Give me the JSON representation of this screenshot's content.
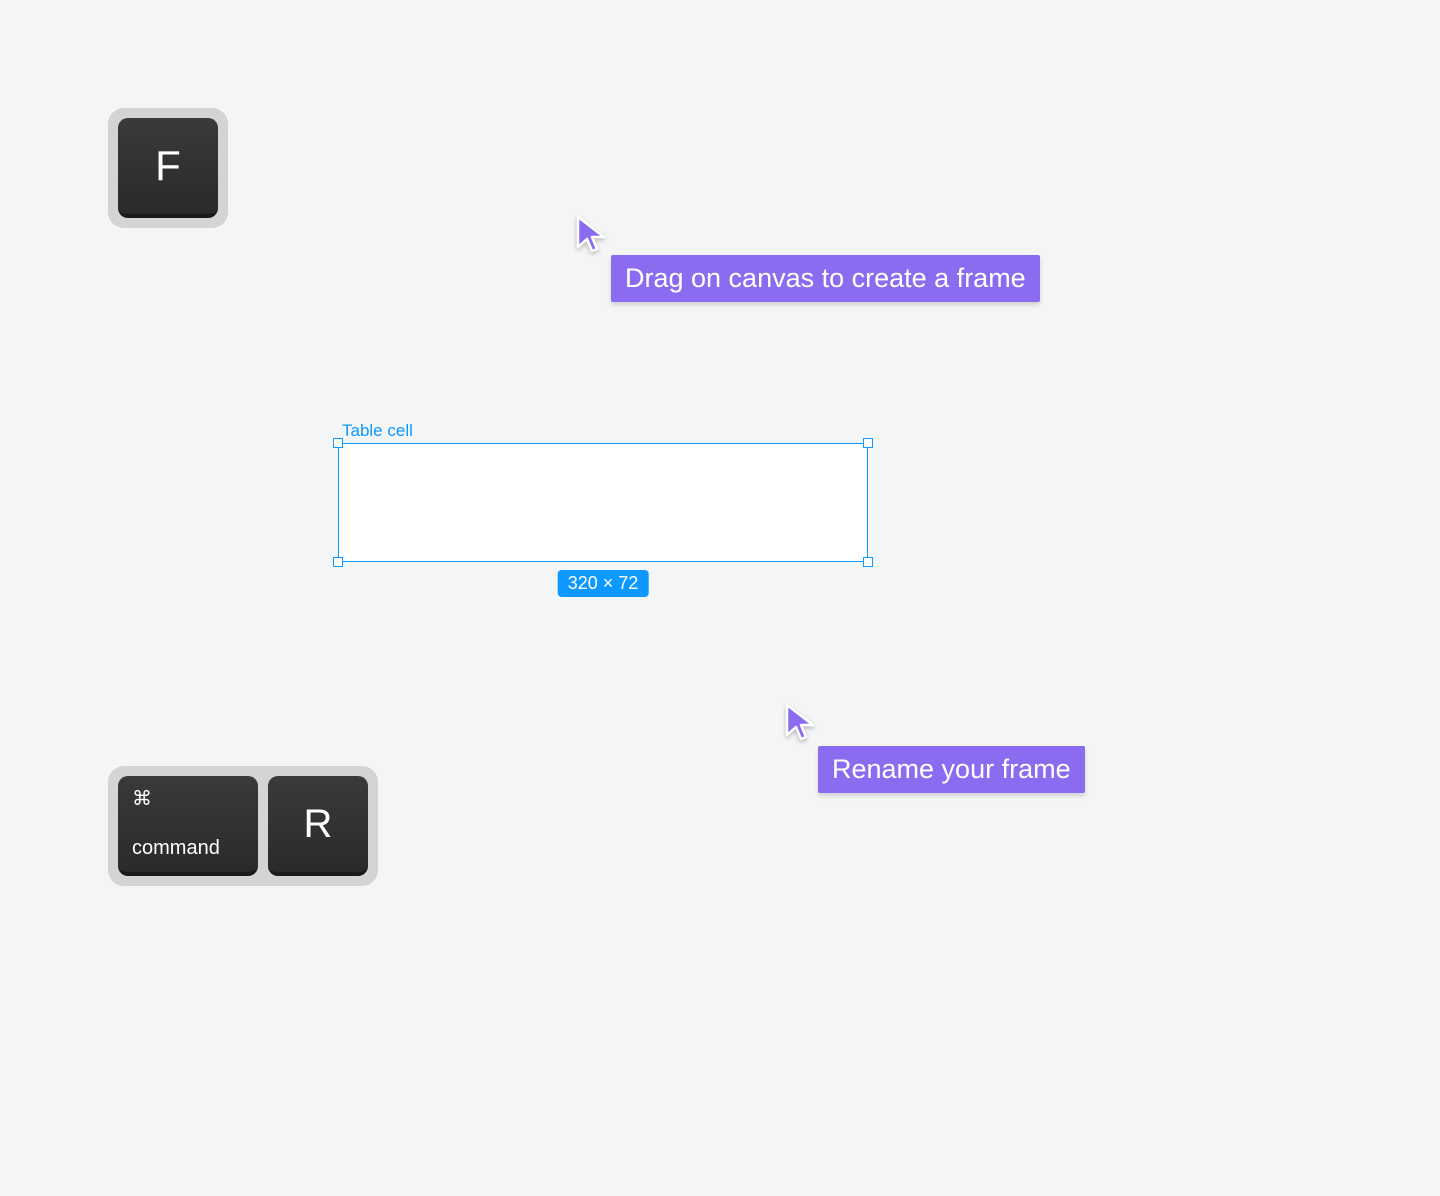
{
  "keys": {
    "f": "F",
    "cmd_symbol": "⌘",
    "cmd_label": "command",
    "r": "R"
  },
  "tooltips": {
    "create_frame": "Drag on canvas to create a frame",
    "rename_frame": "Rename your frame"
  },
  "frame": {
    "label": "Table cell",
    "dimensions": "320 × 72"
  }
}
